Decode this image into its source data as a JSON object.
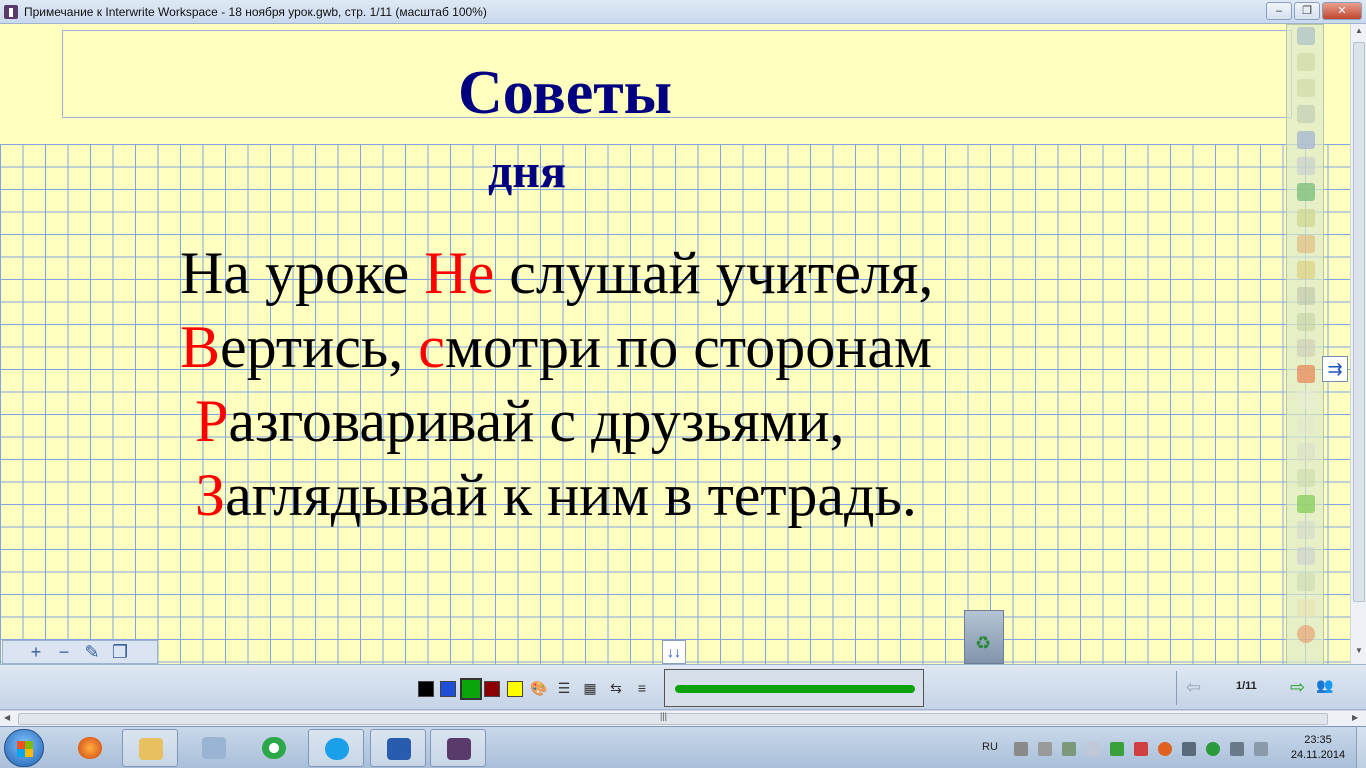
{
  "window": {
    "title": "Примечание к Interwrite Workspace - 18 ноября урок.gwb, стр. 1/11 (масштаб 100%)",
    "minimize_label": "–",
    "restore_label": "❐",
    "close_label": "✕"
  },
  "slide": {
    "heading_line1": "Советы",
    "heading_line2": "дня",
    "heading_color": "#000080",
    "background_color": "#ffffc0",
    "grid_color": "#7fa6e0",
    "lines": [
      {
        "prefix": "На уроке ",
        "accent": "Не",
        "rest": " слушай учителя,"
      },
      {
        "accent": "В",
        "mid": "ертись, ",
        "accent2": "с",
        "rest": "мотри по сторонам"
      },
      {
        "accent": "Р",
        "rest": "азговаривай с друзьями,"
      },
      {
        "accent": "З",
        "rest": "аглядывай к ним в тетрадь."
      }
    ],
    "accent_color": "#ff0000"
  },
  "zoom_panel": {
    "zoom_in_icon": "plus-icon",
    "zoom_out_icon": "minus-icon",
    "edit_icon": "pencil-icon",
    "pages_icon": "pages-icon"
  },
  "bottom_toolbar": {
    "colors": [
      "#000000",
      "#1f4fd6",
      "#0aa30a",
      "#8b0000",
      "#ffff00"
    ],
    "selected_color": "#0aa30a",
    "pen_preview_color": "#0aa30a",
    "page_indicator": "1/11"
  },
  "taskbar": {
    "language": "RU",
    "time": "23:35",
    "date": "24.11.2014"
  }
}
